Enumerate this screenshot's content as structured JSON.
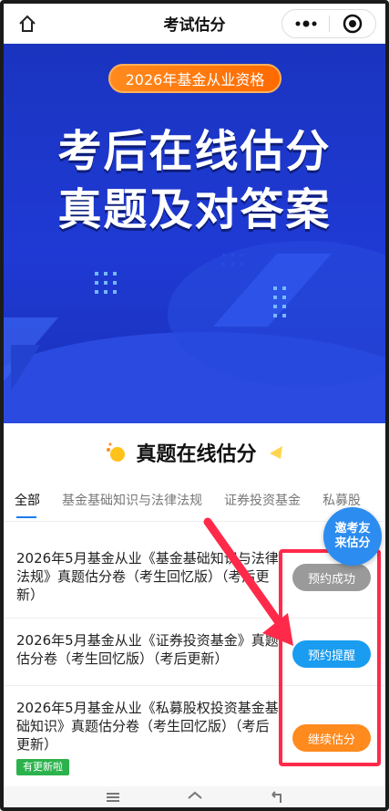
{
  "header": {
    "title": "考试估分",
    "home_icon": "home-icon",
    "more_icon": "more-dots-icon",
    "close_icon": "target-close-icon"
  },
  "banner": {
    "pill": "2026年基金从业资格",
    "line1": "考后在线估分",
    "line2": "真题及对答案"
  },
  "section": {
    "title": "真题在线估分"
  },
  "tabs": [
    {
      "label": "全部",
      "active": true
    },
    {
      "label": "基金基础知识与法律法规",
      "active": false
    },
    {
      "label": "证券投资基金",
      "active": false
    },
    {
      "label": "私募股",
      "active": false
    }
  ],
  "invite": {
    "line1": "邀考友",
    "line2": "来估分"
  },
  "list": [
    {
      "name": "2026年5月基金从业《基金基础知识与法律法规》真题估分卷（考生回忆版）（考后更新）",
      "button": "预约成功",
      "button_color": "#9a9a9a"
    },
    {
      "name": "2026年5月基金从业《证券投资基金》真题估分卷（考生回忆版）（考后更新）",
      "button": "预约提醒",
      "button_color": "#1a9cf0"
    },
    {
      "name": "2026年5月基金从业《私募股权投资基金基础知识》真题估分卷（考生回忆版）（考后更新）",
      "button": "继续估分",
      "button_color": "#ff8a1e",
      "badge": "有更新啦"
    }
  ],
  "colors": {
    "accent": "#1a7cf0",
    "banner_blue": "#1f3ad4",
    "highlight_red": "#ff2a4a"
  }
}
